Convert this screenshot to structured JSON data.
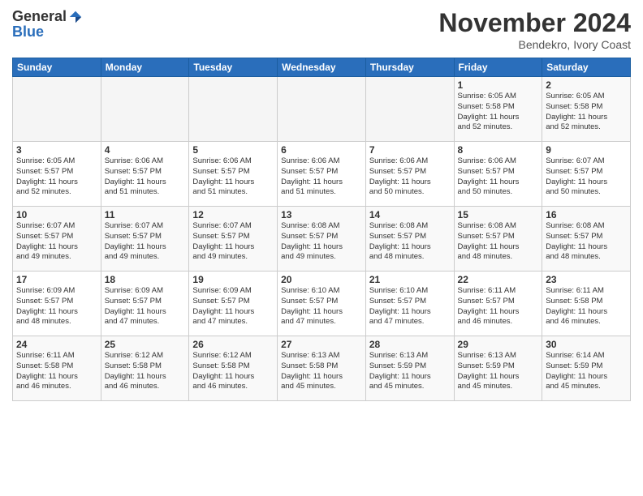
{
  "header": {
    "logo_general": "General",
    "logo_blue": "Blue",
    "month_title": "November 2024",
    "location": "Bendekro, Ivory Coast"
  },
  "days_of_week": [
    "Sunday",
    "Monday",
    "Tuesday",
    "Wednesday",
    "Thursday",
    "Friday",
    "Saturday"
  ],
  "weeks": [
    [
      {
        "day": "",
        "info": ""
      },
      {
        "day": "",
        "info": ""
      },
      {
        "day": "",
        "info": ""
      },
      {
        "day": "",
        "info": ""
      },
      {
        "day": "",
        "info": ""
      },
      {
        "day": "1",
        "info": "Sunrise: 6:05 AM\nSunset: 5:58 PM\nDaylight: 11 hours\nand 52 minutes."
      },
      {
        "day": "2",
        "info": "Sunrise: 6:05 AM\nSunset: 5:58 PM\nDaylight: 11 hours\nand 52 minutes."
      }
    ],
    [
      {
        "day": "3",
        "info": "Sunrise: 6:05 AM\nSunset: 5:57 PM\nDaylight: 11 hours\nand 52 minutes."
      },
      {
        "day": "4",
        "info": "Sunrise: 6:06 AM\nSunset: 5:57 PM\nDaylight: 11 hours\nand 51 minutes."
      },
      {
        "day": "5",
        "info": "Sunrise: 6:06 AM\nSunset: 5:57 PM\nDaylight: 11 hours\nand 51 minutes."
      },
      {
        "day": "6",
        "info": "Sunrise: 6:06 AM\nSunset: 5:57 PM\nDaylight: 11 hours\nand 51 minutes."
      },
      {
        "day": "7",
        "info": "Sunrise: 6:06 AM\nSunset: 5:57 PM\nDaylight: 11 hours\nand 50 minutes."
      },
      {
        "day": "8",
        "info": "Sunrise: 6:06 AM\nSunset: 5:57 PM\nDaylight: 11 hours\nand 50 minutes."
      },
      {
        "day": "9",
        "info": "Sunrise: 6:07 AM\nSunset: 5:57 PM\nDaylight: 11 hours\nand 50 minutes."
      }
    ],
    [
      {
        "day": "10",
        "info": "Sunrise: 6:07 AM\nSunset: 5:57 PM\nDaylight: 11 hours\nand 49 minutes."
      },
      {
        "day": "11",
        "info": "Sunrise: 6:07 AM\nSunset: 5:57 PM\nDaylight: 11 hours\nand 49 minutes."
      },
      {
        "day": "12",
        "info": "Sunrise: 6:07 AM\nSunset: 5:57 PM\nDaylight: 11 hours\nand 49 minutes."
      },
      {
        "day": "13",
        "info": "Sunrise: 6:08 AM\nSunset: 5:57 PM\nDaylight: 11 hours\nand 49 minutes."
      },
      {
        "day": "14",
        "info": "Sunrise: 6:08 AM\nSunset: 5:57 PM\nDaylight: 11 hours\nand 48 minutes."
      },
      {
        "day": "15",
        "info": "Sunrise: 6:08 AM\nSunset: 5:57 PM\nDaylight: 11 hours\nand 48 minutes."
      },
      {
        "day": "16",
        "info": "Sunrise: 6:08 AM\nSunset: 5:57 PM\nDaylight: 11 hours\nand 48 minutes."
      }
    ],
    [
      {
        "day": "17",
        "info": "Sunrise: 6:09 AM\nSunset: 5:57 PM\nDaylight: 11 hours\nand 48 minutes."
      },
      {
        "day": "18",
        "info": "Sunrise: 6:09 AM\nSunset: 5:57 PM\nDaylight: 11 hours\nand 47 minutes."
      },
      {
        "day": "19",
        "info": "Sunrise: 6:09 AM\nSunset: 5:57 PM\nDaylight: 11 hours\nand 47 minutes."
      },
      {
        "day": "20",
        "info": "Sunrise: 6:10 AM\nSunset: 5:57 PM\nDaylight: 11 hours\nand 47 minutes."
      },
      {
        "day": "21",
        "info": "Sunrise: 6:10 AM\nSunset: 5:57 PM\nDaylight: 11 hours\nand 47 minutes."
      },
      {
        "day": "22",
        "info": "Sunrise: 6:11 AM\nSunset: 5:57 PM\nDaylight: 11 hours\nand 46 minutes."
      },
      {
        "day": "23",
        "info": "Sunrise: 6:11 AM\nSunset: 5:58 PM\nDaylight: 11 hours\nand 46 minutes."
      }
    ],
    [
      {
        "day": "24",
        "info": "Sunrise: 6:11 AM\nSunset: 5:58 PM\nDaylight: 11 hours\nand 46 minutes."
      },
      {
        "day": "25",
        "info": "Sunrise: 6:12 AM\nSunset: 5:58 PM\nDaylight: 11 hours\nand 46 minutes."
      },
      {
        "day": "26",
        "info": "Sunrise: 6:12 AM\nSunset: 5:58 PM\nDaylight: 11 hours\nand 46 minutes."
      },
      {
        "day": "27",
        "info": "Sunrise: 6:13 AM\nSunset: 5:58 PM\nDaylight: 11 hours\nand 45 minutes."
      },
      {
        "day": "28",
        "info": "Sunrise: 6:13 AM\nSunset: 5:59 PM\nDaylight: 11 hours\nand 45 minutes."
      },
      {
        "day": "29",
        "info": "Sunrise: 6:13 AM\nSunset: 5:59 PM\nDaylight: 11 hours\nand 45 minutes."
      },
      {
        "day": "30",
        "info": "Sunrise: 6:14 AM\nSunset: 5:59 PM\nDaylight: 11 hours\nand 45 minutes."
      }
    ]
  ]
}
